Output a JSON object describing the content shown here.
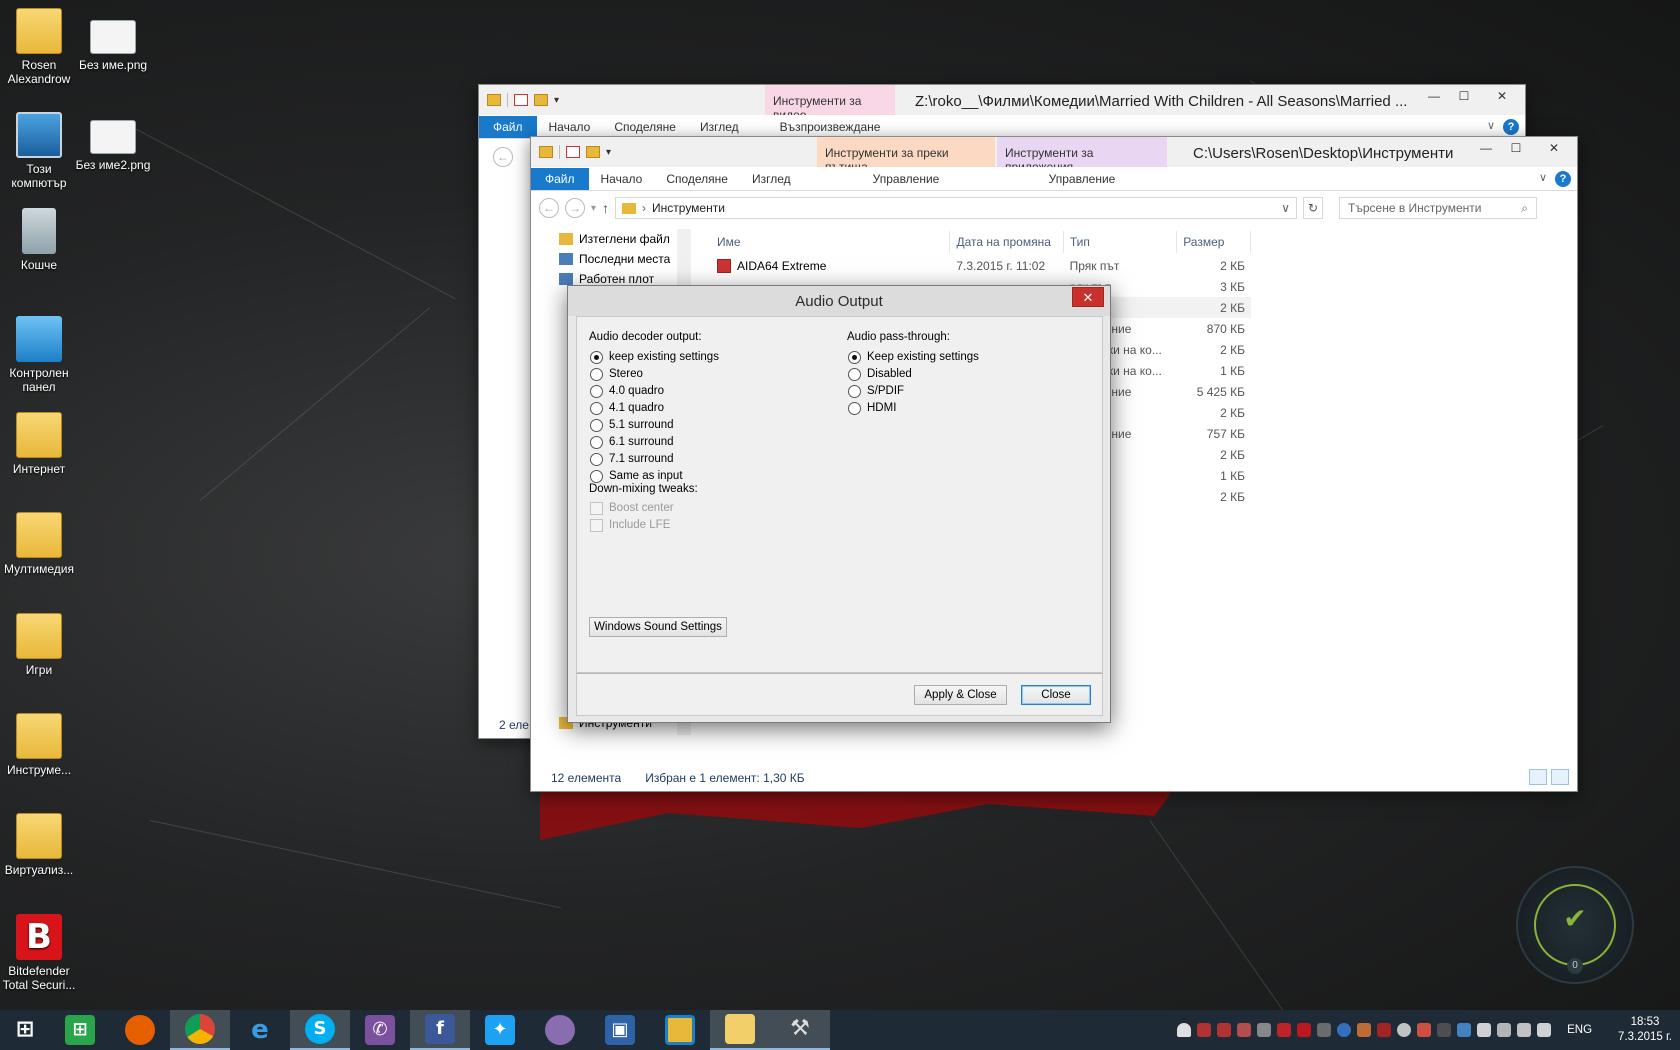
{
  "desktop": {
    "icons": [
      {
        "label": "Rosen Alexandrow",
        "icon": "user-folder-icon"
      },
      {
        "label": "Без име.png",
        "icon": "image-file-icon"
      },
      {
        "label": "Този компютър",
        "icon": "computer-icon"
      },
      {
        "label": "Без име2.png",
        "icon": "image-file-icon"
      },
      {
        "label": "Кошче",
        "icon": "recycle-bin-icon"
      },
      {
        "label": "Контролен панел",
        "icon": "control-panel-icon"
      },
      {
        "label": "Интернет",
        "icon": "folder-icon"
      },
      {
        "label": "Мултимедия",
        "icon": "folder-icon"
      },
      {
        "label": "Игри",
        "icon": "folder-icon"
      },
      {
        "label": "Инструме...",
        "icon": "folder-icon"
      },
      {
        "label": "Виртуализ...",
        "icon": "folder-icon"
      },
      {
        "label": "Bitdefender Total Securi...",
        "icon": "bitdefender-icon"
      }
    ]
  },
  "window_back": {
    "context_tab": "Инструменти за видео",
    "context_subtab": "Възпроизвеждане",
    "title": "Z:\\roko__\\Филми\\Комедии\\Married With Children - All Seasons\\Married ...",
    "tabs": [
      "Файл",
      "Начало",
      "Споделяне",
      "Изглед"
    ],
    "status": "2 еле"
  },
  "window_front": {
    "context_tab_1": "Инструменти за преки пътища",
    "context_tab_2": "Инструменти за приложения",
    "context_sub_1": "Управление",
    "context_sub_2": "Управление",
    "title": "C:\\Users\\Rosen\\Desktop\\Инструменти",
    "tabs": [
      "Файл",
      "Начало",
      "Споделяне",
      "Изглед"
    ],
    "address": "Инструменти",
    "search_placeholder": "Търсене в Инструменти",
    "nav_items": [
      "Изтеглени файл",
      "Последни места",
      "Работен плот",
      "Инструменти"
    ],
    "columns": [
      "Име",
      "Дата на промяна",
      "Тип",
      "Размер"
    ],
    "rows": [
      {
        "name": "AIDA64 Extreme",
        "date": "7.3.2015 г. 11:02",
        "type": "Пряк път",
        "size": "2 КБ"
      },
      {
        "name": "",
        "date": "",
        "type": "ряк път",
        "size": "3 КБ"
      },
      {
        "name": "",
        "date": "",
        "type": "ряк път",
        "size": "2 КБ"
      },
      {
        "name": "",
        "date": "",
        "type": "риложение",
        "size": "870 КБ"
      },
      {
        "name": "",
        "date": "",
        "type": "астройки на ко...",
        "size": "2 КБ"
      },
      {
        "name": "",
        "date": "",
        "type": "астройки на ко...",
        "size": "1 КБ"
      },
      {
        "name": "",
        "date": "",
        "type": "риложение",
        "size": "5 425 КБ"
      },
      {
        "name": "",
        "date": "",
        "type": "ряк път",
        "size": "2 КБ"
      },
      {
        "name": "",
        "date": "",
        "type": "риложение",
        "size": "757 КБ"
      },
      {
        "name": "",
        "date": "",
        "type": "ряк път",
        "size": "2 КБ"
      },
      {
        "name": "",
        "date": "",
        "type": "ряк път",
        "size": "1 КБ"
      },
      {
        "name": "",
        "date": "",
        "type": "ряк път",
        "size": "2 КБ"
      }
    ],
    "status_count": "12 елемента",
    "status_selected": "Избран е 1 елемент: 1,30 КБ"
  },
  "dialog": {
    "title": "Audio Output",
    "decoder_label": "Audio decoder output:",
    "decoder_options": [
      "keep existing settings",
      "Stereo",
      "4.0 quadro",
      "4.1 quadro",
      "5.1 surround",
      "6.1 surround",
      "7.1 surround",
      "Same as input"
    ],
    "decoder_selected": 0,
    "downmix_label": "Down-mixing tweaks:",
    "downmix_options": [
      "Boost center",
      "Include LFE"
    ],
    "passthrough_label": "Audio pass-through:",
    "passthrough_options": [
      "Keep existing settings",
      "Disabled",
      "S/PDIF",
      "HDMI"
    ],
    "passthrough_selected": 0,
    "sound_settings_button": "Windows Sound Settings",
    "apply_close_button": "Apply & Close",
    "close_button": "Close"
  },
  "taskbar": {
    "apps": [
      "start",
      "store",
      "firefox",
      "chrome",
      "internet-explorer",
      "skype",
      "viber",
      "facebook",
      "twitter",
      "pidgin",
      "virtualbox",
      "outlook-folder",
      "file-explorer",
      "tools"
    ],
    "language": "ENG",
    "time": "18:53",
    "date": "7.3.2015 г."
  },
  "bitdefender_widget": {
    "count": "0"
  }
}
